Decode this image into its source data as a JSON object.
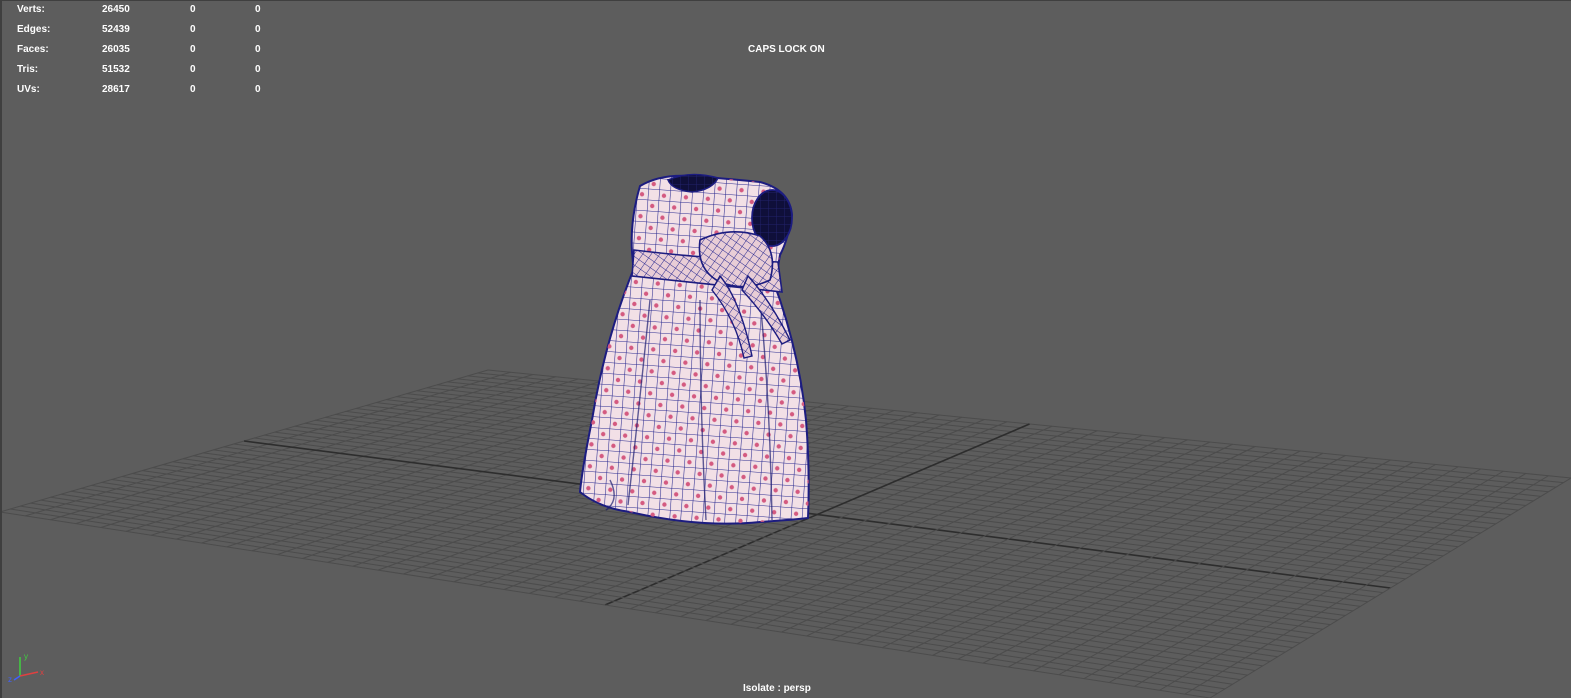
{
  "stats": [
    {
      "label": "Verts:",
      "values": [
        "26450",
        "0",
        "0"
      ]
    },
    {
      "label": "Edges:",
      "values": [
        "52439",
        "0",
        "0"
      ]
    },
    {
      "label": "Faces:",
      "values": [
        "26035",
        "0",
        "0"
      ]
    },
    {
      "label": "Tris:",
      "values": [
        "51532",
        "0",
        "0"
      ]
    },
    {
      "label": "UVs:",
      "values": [
        "28617",
        "0",
        "0"
      ]
    }
  ],
  "caps_lock": "CAPS LOCK ON",
  "isolate": "Isolate : persp",
  "axis": {
    "x": "x",
    "y": "y",
    "z": "z"
  },
  "colors": {
    "viewport_bg": "#5d5d5d",
    "grid_line": "#4c4c4c",
    "grid_axis": "#2d2d2d",
    "dress_fill": "#f0dde3",
    "wireframe": "#2a2a90",
    "polka_dot": "#d45a80",
    "axis_x": "#e04040",
    "axis_y": "#40d040",
    "axis_z": "#4060ff"
  }
}
